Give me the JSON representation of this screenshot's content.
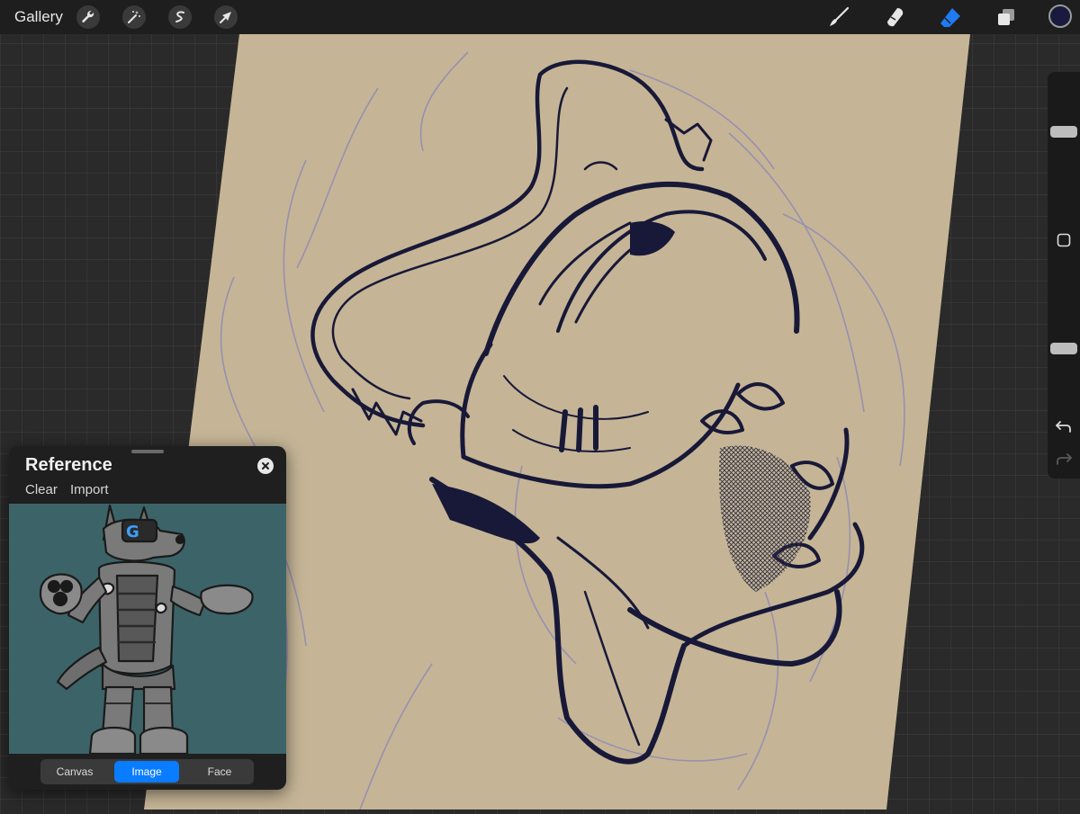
{
  "topbar": {
    "gallery_label": "Gallery",
    "left_tools": [
      {
        "name": "actions",
        "icon": "wrench-icon"
      },
      {
        "name": "adjustments",
        "icon": "magic-wand-icon"
      },
      {
        "name": "selection",
        "icon": "selection-s-icon"
      },
      {
        "name": "transform",
        "icon": "arrow-cursor-icon"
      }
    ],
    "right_tools": [
      {
        "name": "brush",
        "icon": "brush-icon",
        "active": false
      },
      {
        "name": "smudge",
        "icon": "smudge-icon",
        "active": false
      },
      {
        "name": "eraser",
        "icon": "eraser-icon",
        "active": true
      },
      {
        "name": "layers",
        "icon": "layers-icon",
        "active": false
      }
    ],
    "current_color": "#1a1a3e",
    "active_tool_color": "#1e7bf2"
  },
  "sidebar": {
    "brush_size_level": 0.62,
    "opacity_level": 0.3,
    "modify_icon": "square-button-icon",
    "undo_icon": "undo-icon",
    "redo_icon": "redo-icon"
  },
  "canvas": {
    "paper_color": "#c5b596",
    "ink_color": "#181838",
    "sketch_color": "#8a84b8"
  },
  "reference_panel": {
    "title": "Reference",
    "clear_label": "Clear",
    "import_label": "Import",
    "image_background": "#3c6468",
    "tabs": [
      {
        "label": "Canvas",
        "active": false
      },
      {
        "label": "Image",
        "active": true
      },
      {
        "label": "Face",
        "active": false
      }
    ]
  }
}
